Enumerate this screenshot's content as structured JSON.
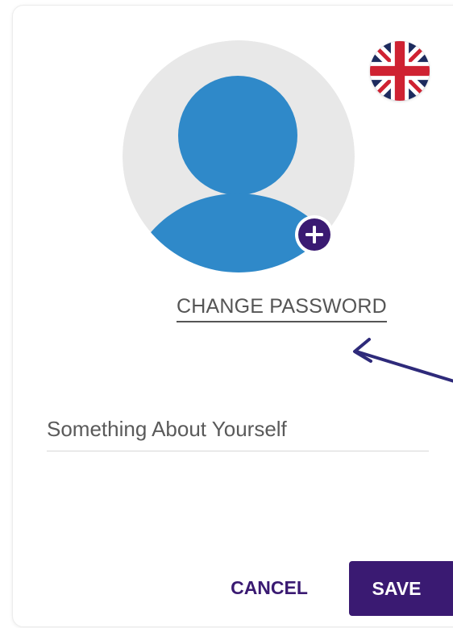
{
  "profile": {
    "avatar_icon": "default-user-avatar-icon",
    "add_photo_icon": "plus-icon",
    "language_flag_icon": "united-kingdom-flag-icon"
  },
  "actions": {
    "change_password_label": "CHANGE PASSWORD"
  },
  "about": {
    "value": "",
    "placeholder": "Something About Yourself"
  },
  "footer": {
    "cancel_label": "CANCEL",
    "save_label": "SAVE"
  },
  "colors": {
    "accent": "#3a1a72",
    "avatar_background": "#e8e8e8",
    "avatar_figure": "#2f89c9",
    "flag_blue": "#1d2b5e",
    "flag_red": "#cf2232",
    "link_text": "#555555",
    "arrow": "#2e2a7a"
  }
}
